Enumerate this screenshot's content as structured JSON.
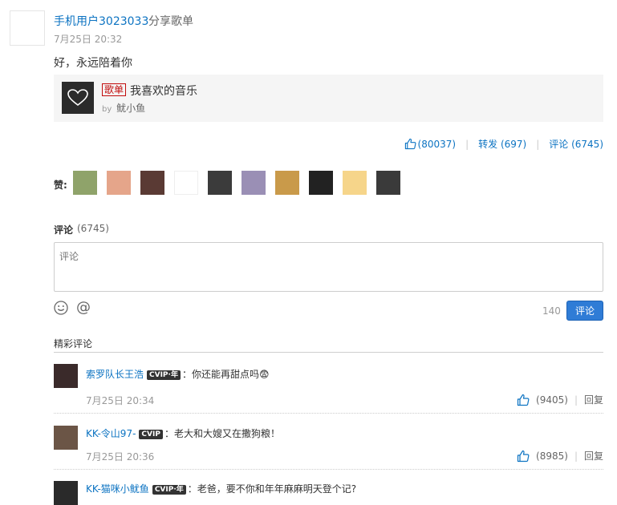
{
  "post": {
    "username": "手机用户3023033",
    "action": "分享歌单",
    "time": "7月25日 20:32",
    "text": "好，永远陪着你"
  },
  "share": {
    "tag": "歌单",
    "title": "我喜欢的音乐",
    "by_label": "by",
    "author": "鱿小鱼"
  },
  "ops": {
    "like": "(80037)",
    "forward": "转发 (697)",
    "comment": "评论 (6745)"
  },
  "likes_label": "赞:",
  "likers": [
    {
      "color": "#8fa36a"
    },
    {
      "color": "#e5a58a"
    },
    {
      "color": "#5a3a34"
    },
    {
      "color": "#ffffff"
    },
    {
      "color": "#3b3b3b"
    },
    {
      "color": "#9a8fb5"
    },
    {
      "color": "#c99a4a"
    },
    {
      "color": "#222222"
    },
    {
      "color": "#f6d58a"
    },
    {
      "color": "#3a3a3a"
    }
  ],
  "comment_box": {
    "title": "评论",
    "count": "(6745)",
    "placeholder": "评论",
    "limit": "140",
    "submit": "评论"
  },
  "hot_title": "精彩评论",
  "comments": [
    {
      "user": "索罗队长王浩",
      "vip": "CVIP·年",
      "text": "：你还能再甜点吗😨",
      "time": "7月25日 20:34",
      "likes": "(9405)",
      "reply": "回复",
      "avatar_color": "#3a2a2a"
    },
    {
      "user": "KK-令山97-",
      "vip": "CVIP",
      "text": "：老大和大嫂又在撒狗粮！",
      "time": "7月25日 20:36",
      "likes": "(8985)",
      "reply": "回复",
      "avatar_color": "#6b5546"
    },
    {
      "user": "KK-猫咪小鱿鱼",
      "vip": "CVIP·年",
      "text": "：老爸，要不你和年年麻麻明天登个记?",
      "time": "",
      "likes": "",
      "reply": "",
      "avatar_color": "#2a2a2a"
    }
  ]
}
